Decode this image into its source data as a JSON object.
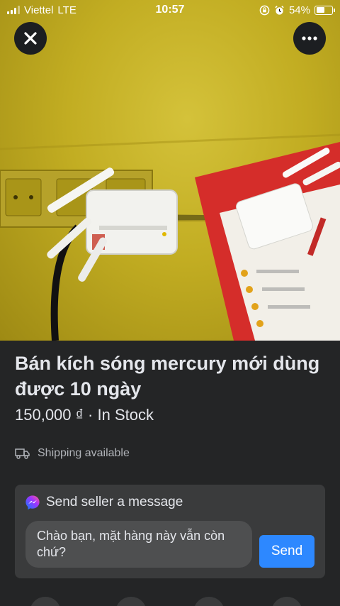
{
  "status_bar": {
    "carrier": "Viettel",
    "network": "LTE",
    "time": "10:57",
    "battery_percent": "54%",
    "battery_level": 0.54,
    "signal_bars_on": 3,
    "icons": [
      "signal-icon",
      "lock-rotation-icon",
      "alarm-icon",
      "battery-icon"
    ]
  },
  "photo": {
    "label": "product-photo"
  },
  "top_actions": {
    "close_icon": "close-icon",
    "more_icon": "more-icon"
  },
  "listing": {
    "title": "Bán kích sóng mercury mới dùng được 10 ngày",
    "price": "150,000 ₫ · In Stock",
    "shipping_label": "Shipping available",
    "shipping_icon": "truck-icon"
  },
  "message": {
    "header": "Send seller a message",
    "header_icon": "messenger-icon",
    "input_value": "Chào bạn, mặt hàng này vẫn còn chứ?",
    "send_label": "Send"
  },
  "colors": {
    "background": "#242526",
    "card": "#3a3b3c",
    "accent": "#2d88ff",
    "text": "#e4e6eb",
    "secondary_text": "#b0b3b8"
  }
}
